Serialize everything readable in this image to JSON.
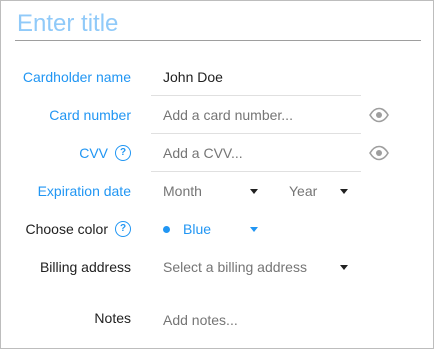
{
  "title": {
    "placeholder": "Enter title",
    "value": ""
  },
  "cardholder": {
    "label": "Cardholder name",
    "value": "John Doe"
  },
  "card_number": {
    "label": "Card number",
    "placeholder": "Add a card number..."
  },
  "cvv": {
    "label": "CVV",
    "help": "?",
    "placeholder": "Add a CVV..."
  },
  "expiration": {
    "label": "Expiration date",
    "month": "Month",
    "year": "Year"
  },
  "color": {
    "label": "Choose color",
    "help": "?",
    "value": "Blue",
    "dot_color": "#2196f3"
  },
  "billing": {
    "label": "Billing address",
    "placeholder": "Select a billing address"
  },
  "notes": {
    "label": "Notes",
    "placeholder": "Add notes..."
  },
  "icons": {
    "reveal": "eye-icon",
    "help": "question-circle-icon",
    "dropdown": "caret-down-icon"
  },
  "colors": {
    "accent": "#2196f3",
    "title_placeholder": "#90caf9",
    "text": "#212121",
    "muted": "#757575"
  }
}
